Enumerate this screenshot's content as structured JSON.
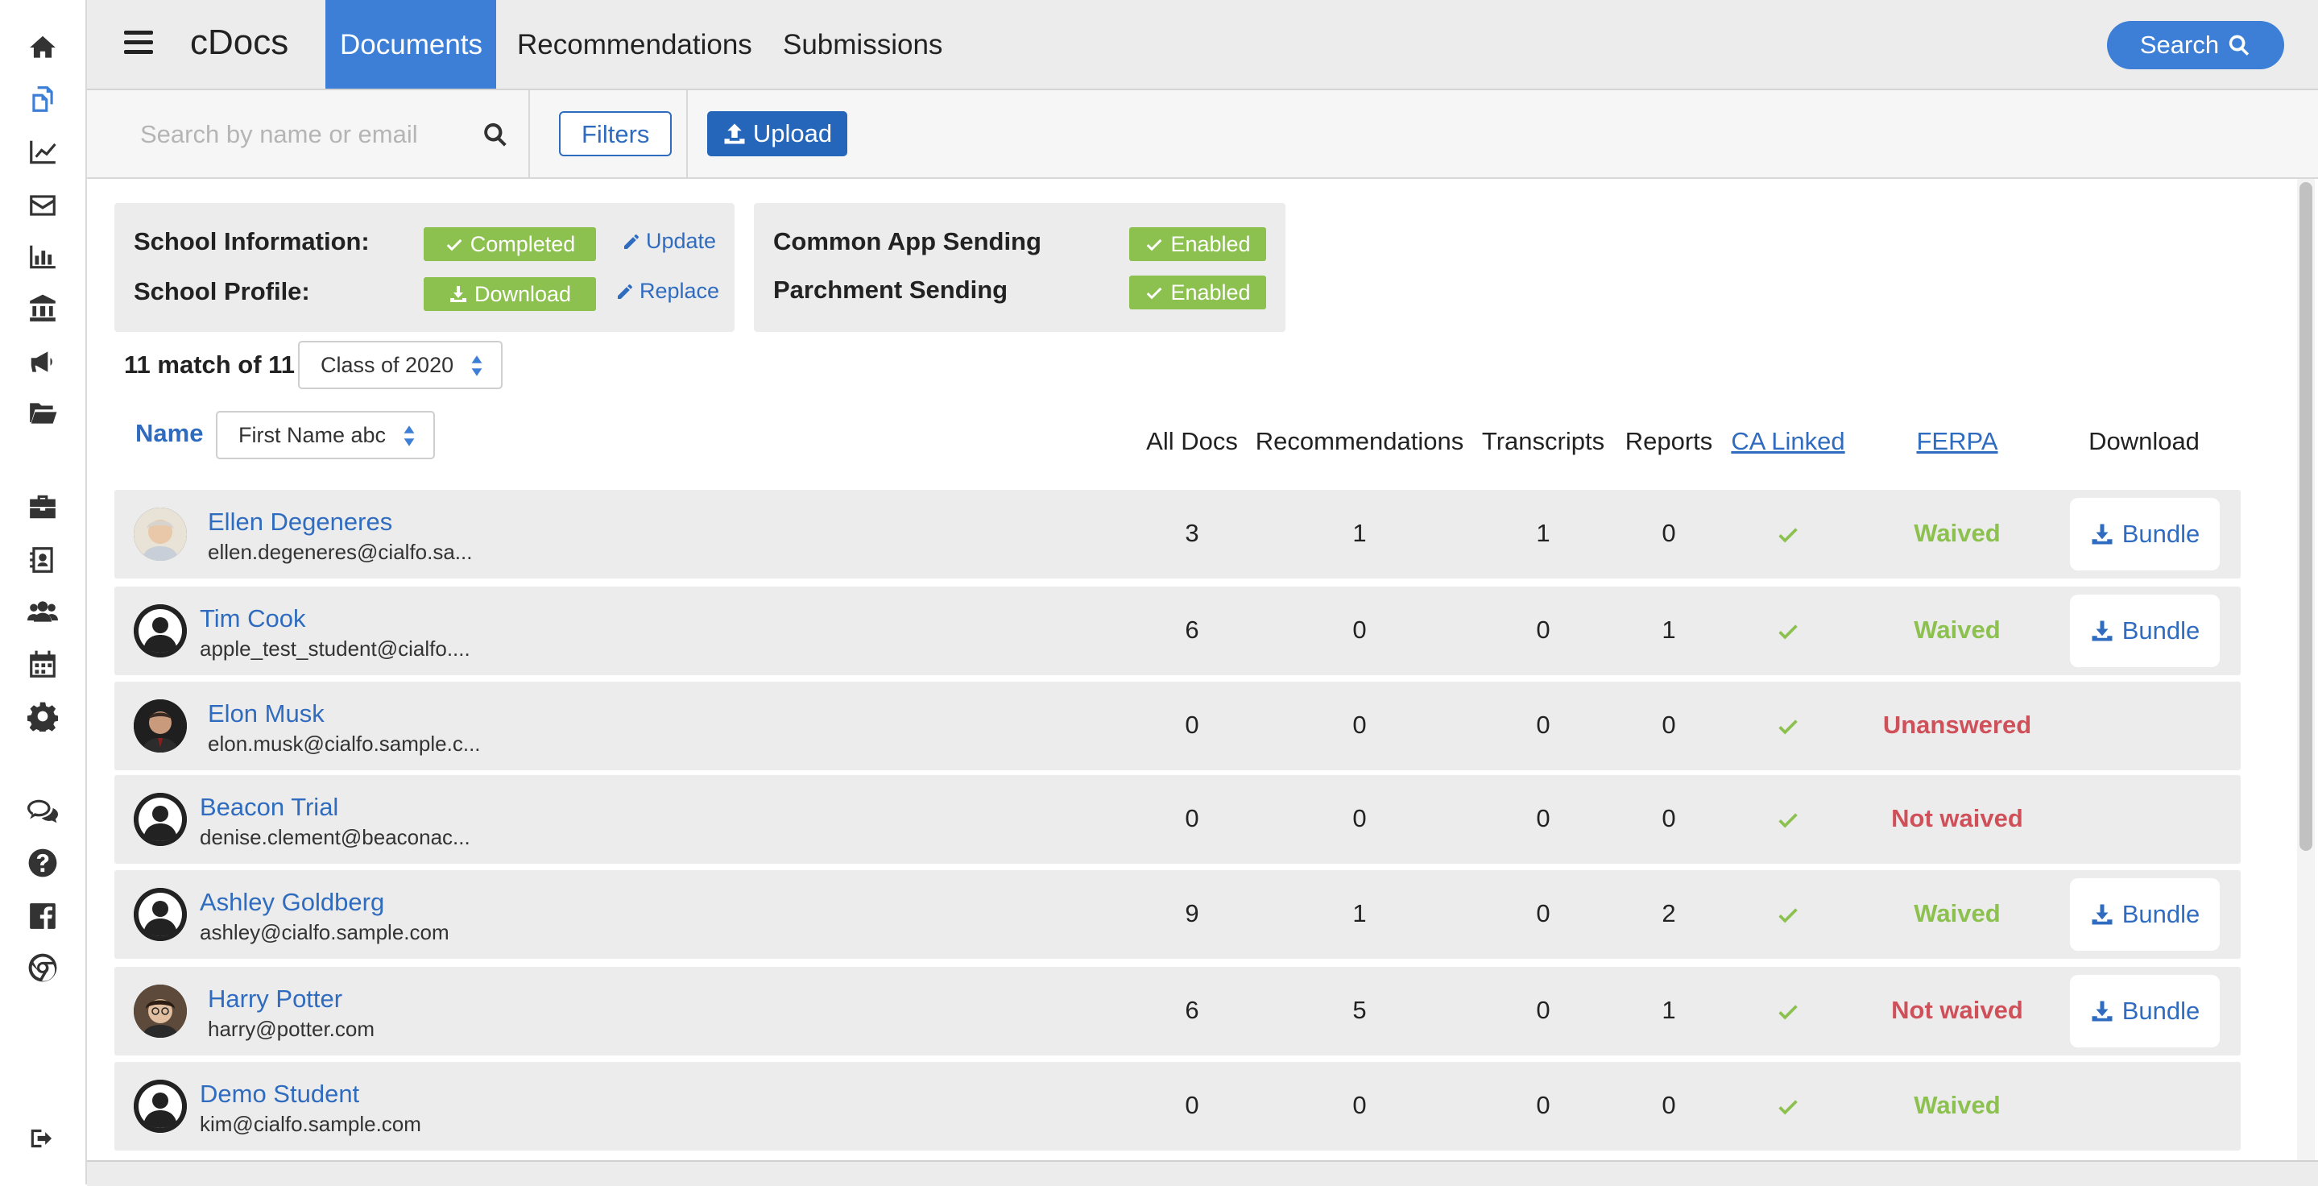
{
  "sidebar": {
    "icons": [
      "home-icon",
      "documents-icon",
      "analytics-icon",
      "mail-icon",
      "reports-icon",
      "institution-icon",
      "announcements-icon",
      "folder-icon",
      "briefcase-icon",
      "contacts-icon",
      "users-icon",
      "calendar-icon",
      "settings-icon",
      "chat-icon",
      "help-icon",
      "facebook-icon",
      "chrome-icon",
      "logout-icon"
    ],
    "active": "documents-icon"
  },
  "header": {
    "brand": "cDocs",
    "tabs": [
      {
        "label": "Documents",
        "active": true
      },
      {
        "label": "Recommendations",
        "active": false
      },
      {
        "label": "Submissions",
        "active": false
      }
    ],
    "search_label": "Search"
  },
  "toolbar": {
    "search_placeholder": "Search by name or email",
    "filters_label": "Filters",
    "upload_label": "Upload"
  },
  "school_panel": {
    "info_label": "School Information:",
    "info_status": "Completed",
    "info_action": "Update",
    "profile_label": "School Profile:",
    "profile_status": "Download",
    "profile_action": "Replace"
  },
  "sending_panel": {
    "common_app_label": "Common App Sending",
    "common_app_status": "Enabled",
    "parchment_label": "Parchment Sending",
    "parchment_status": "Enabled"
  },
  "list": {
    "match_text": "11 match of 11",
    "class_filter": "Class of 2020",
    "name_header": "Name",
    "sort_value": "First Name abc",
    "columns": {
      "all_docs": "All Docs",
      "recommendations": "Recommendations",
      "transcripts": "Transcripts",
      "reports": "Reports",
      "ca_linked": "CA Linked",
      "ferpa": "FERPA",
      "download": "Download"
    },
    "bundle_label": "Bundle",
    "rows": [
      {
        "name": "Ellen Degeneres",
        "email": "ellen.degeneres@cialfo.sa...",
        "all_docs": "3",
        "recommendations": "1",
        "transcripts": "1",
        "reports": "0",
        "ca_linked": true,
        "ferpa": "Waived",
        "bundle": true,
        "avatar": "photo"
      },
      {
        "name": "Tim Cook",
        "email": "apple_test_student@cialfo....",
        "all_docs": "6",
        "recommendations": "0",
        "transcripts": "0",
        "reports": "1",
        "ca_linked": true,
        "ferpa": "Waived",
        "bundle": true,
        "avatar": "default"
      },
      {
        "name": "Elon Musk",
        "email": "elon.musk@cialfo.sample.c...",
        "all_docs": "0",
        "recommendations": "0",
        "transcripts": "0",
        "reports": "0",
        "ca_linked": true,
        "ferpa": "Unanswered",
        "bundle": false,
        "avatar": "photo"
      },
      {
        "name": "Beacon Trial",
        "email": "denise.clement@beaconac...",
        "all_docs": "0",
        "recommendations": "0",
        "transcripts": "0",
        "reports": "0",
        "ca_linked": true,
        "ferpa": "Not waived",
        "bundle": false,
        "avatar": "default"
      },
      {
        "name": "Ashley Goldberg",
        "email": "ashley@cialfo.sample.com",
        "all_docs": "9",
        "recommendations": "1",
        "transcripts": "0",
        "reports": "2",
        "ca_linked": true,
        "ferpa": "Waived",
        "bundle": true,
        "avatar": "default"
      },
      {
        "name": "Harry Potter",
        "email": "harry@potter.com",
        "all_docs": "6",
        "recommendations": "5",
        "transcripts": "0",
        "reports": "1",
        "ca_linked": true,
        "ferpa": "Not waived",
        "bundle": true,
        "avatar": "photo"
      },
      {
        "name": "Demo Student",
        "email": "kim@cialfo.sample.com",
        "all_docs": "0",
        "recommendations": "0",
        "transcripts": "0",
        "reports": "0",
        "ca_linked": true,
        "ferpa": "Waived",
        "bundle": false,
        "avatar": "default"
      }
    ]
  },
  "colors": {
    "accent": "#3d7fd6",
    "link": "#2f6cbf",
    "success": "#8cc14f",
    "danger": "#d0505a",
    "panel": "#ececec"
  }
}
